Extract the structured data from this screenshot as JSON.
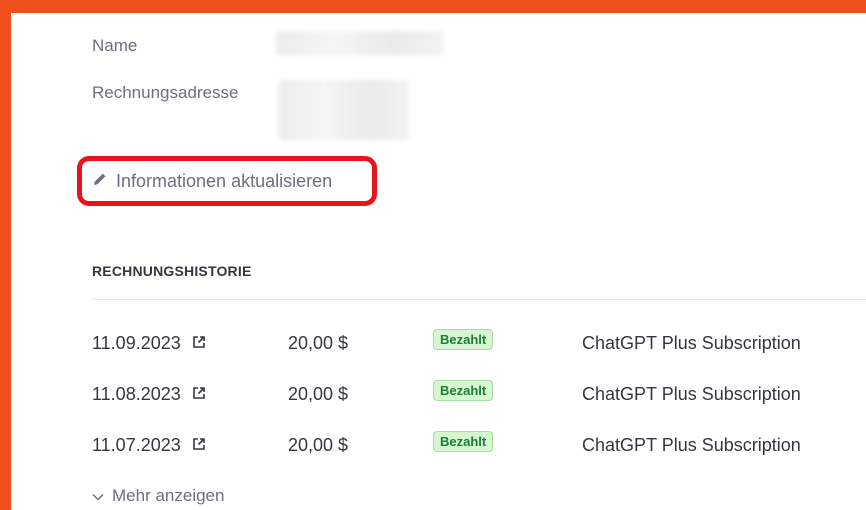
{
  "billing_info": {
    "name_label": "Name",
    "address_label": "Rechnungsadresse",
    "update_link": "Informationen aktualisieren"
  },
  "history": {
    "title": "RECHNUNGSHISTORIE",
    "rows": [
      {
        "date": "11.09.2023",
        "amount": "20,00 $",
        "status": "Bezahlt",
        "description": "ChatGPT Plus Subscription"
      },
      {
        "date": "11.08.2023",
        "amount": "20,00 $",
        "status": "Bezahlt",
        "description": "ChatGPT Plus Subscription"
      },
      {
        "date": "11.07.2023",
        "amount": "20,00 $",
        "status": "Bezahlt",
        "description": "ChatGPT Plus Subscription"
      }
    ],
    "show_more": "Mehr anzeigen"
  },
  "colors": {
    "highlight_frame": "#f0501e",
    "annotation_box": "#e8141c",
    "paid_badge_bg": "#d6f5d1",
    "paid_badge_text": "#1a7f37"
  },
  "icons": [
    "pencil-icon",
    "external-link-icon",
    "chevron-down-icon"
  ]
}
